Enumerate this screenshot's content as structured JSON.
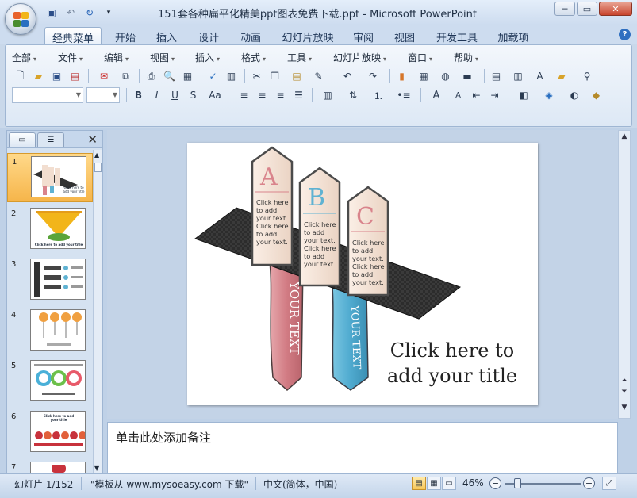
{
  "title_bar": {
    "title": "151套各种扁平化精美ppt图表免费下载.ppt - Microsoft PowerPoint",
    "quick_access": [
      "save-icon",
      "undo-icon",
      "redo-icon",
      "customize-icon"
    ],
    "controls": {
      "minimize": "─",
      "maximize": "▭",
      "close": "✕"
    }
  },
  "ribbon": {
    "tabs": [
      "经典菜单",
      "开始",
      "插入",
      "设计",
      "动画",
      "幻灯片放映",
      "审阅",
      "视图",
      "开发工具",
      "加载项"
    ],
    "active_tab": "经典菜单",
    "help": "?",
    "menus": [
      "全部",
      "文件",
      "编辑",
      "视图",
      "插入",
      "格式",
      "工具",
      "幻灯片放映",
      "窗口",
      "帮助"
    ],
    "menu_arrow": "▾",
    "font_buttons": [
      "B",
      "I",
      "U",
      "S",
      "Aa"
    ],
    "font_size_buttons": [
      "A",
      "A"
    ]
  },
  "slides_panel": {
    "close_symbol": "✕",
    "slides": [
      {
        "number": "1",
        "selected": true
      },
      {
        "number": "2",
        "selected": false
      },
      {
        "number": "3",
        "selected": false
      },
      {
        "number": "4",
        "selected": false
      },
      {
        "number": "5",
        "selected": false
      },
      {
        "number": "6",
        "selected": false
      },
      {
        "number": "7",
        "selected": false
      }
    ],
    "thumb_captions": {
      "slide1": "Click here to add your title",
      "slide2": "Click here to add your title",
      "slide6": "Click here to add your title"
    }
  },
  "slide": {
    "title_line1": "Click here to",
    "title_line2": "add your title",
    "columns": [
      {
        "letter": "A",
        "text": "Click here to add your text. Click here to add your text.",
        "label": "",
        "color": "#d9848c"
      },
      {
        "letter": "B",
        "text": "Click here to add your text. Click here to add your text.",
        "label": "",
        "color": "#5fb2d2"
      },
      {
        "letter": "C",
        "text": "Click here to add your text. Click here to add your text.",
        "label": "",
        "color": "#d9848c"
      }
    ],
    "ribbon_labels": [
      "YOUR TEXT",
      "YOUR TEXT"
    ]
  },
  "notes": {
    "placeholder": "单击此处添加备注"
  },
  "status_bar": {
    "slide_counter": "幻灯片 1/152",
    "template": "\"模板从 www.mysoeasy.com 下载\"",
    "language": "中文(简体，中国)",
    "zoom": "46%",
    "zoom_out": "−",
    "zoom_in": "+"
  },
  "colors": {
    "accent_pink": "#d9848c",
    "accent_blue": "#5fb2d2",
    "band": "#2b2b2b",
    "selected_thumb": "#f6b54a"
  }
}
